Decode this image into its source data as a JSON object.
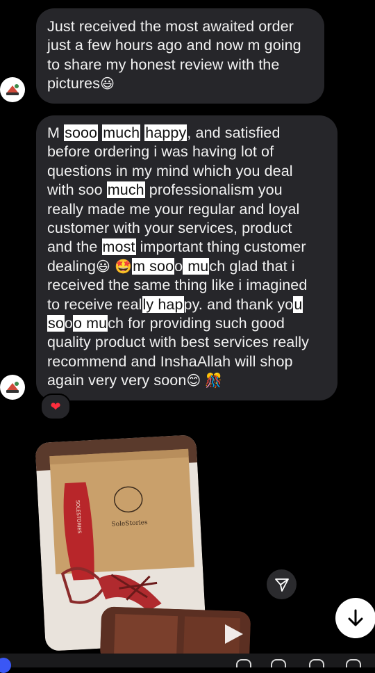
{
  "messages": [
    {
      "lines": [
        [
          {
            "t": "Just received the most awaited order"
          }
        ],
        [
          {
            "t": "just a few hours ago and now m going"
          }
        ],
        [
          {
            "t": "to share my honest review with the"
          }
        ],
        [
          {
            "t": "pictures"
          },
          {
            "t": "😃",
            "e": 1
          }
        ]
      ]
    },
    {
      "lines": [
        [
          {
            "t": "M "
          },
          {
            "t": "sooo",
            "h": 1
          },
          {
            "t": " "
          },
          {
            "t": "much",
            "h": 1
          },
          {
            "t": " "
          },
          {
            "t": "happy",
            "h": 1
          },
          {
            "t": ", and satisfied"
          }
        ],
        [
          {
            "t": "before ordering i was having lot of"
          }
        ],
        [
          {
            "t": "questions in my mind which you deal"
          }
        ],
        [
          {
            "t": "with soo "
          },
          {
            "t": "much",
            "h": 1
          },
          {
            "t": " professionalism you"
          }
        ],
        [
          {
            "t": "really made me your regular and loyal"
          }
        ],
        [
          {
            "t": "customer with your services, product"
          }
        ],
        [
          {
            "t": "and the "
          },
          {
            "t": "most",
            "h": 1
          },
          {
            "t": " important thing customer"
          }
        ],
        [
          {
            "t": "dealing"
          },
          {
            "t": "😃",
            "e": 1
          },
          {
            "t": " "
          },
          {
            "t": "🤩",
            "e": 1
          },
          {
            "t": "m soo",
            "h": 1
          },
          {
            "t": "o"
          },
          {
            "t": " mu",
            "h": 1
          },
          {
            "t": "ch glad that i"
          }
        ],
        [
          {
            "t": "received the same thing like i imagined"
          }
        ],
        [
          {
            "t": "to receive real"
          },
          {
            "t": "ly hap",
            "h": 1
          },
          {
            "t": "py. and thank yo"
          },
          {
            "t": "u",
            "h": 1
          }
        ],
        [
          {
            "t": "so",
            "h": 1
          },
          {
            "t": "o"
          },
          {
            "t": "o mu",
            "h": 1
          },
          {
            "t": "ch for providing such good"
          }
        ],
        [
          {
            "t": "quality product with best services really"
          }
        ],
        [
          {
            "t": "recommend and InshaAllah will shop"
          }
        ],
        [
          {
            "t": "again very very soon"
          },
          {
            "t": "😊",
            "e": 1
          },
          {
            "t": " "
          },
          {
            "t": "🎊",
            "e": 1
          }
        ]
      ]
    }
  ],
  "reaction": "❤",
  "photo": {
    "box_brand_side": "SOLESTORIES",
    "box_brand_front": "SoleStories"
  },
  "icons": {
    "share": "send-icon",
    "scroll": "arrow-down-icon",
    "play": "play-icon"
  },
  "colors": {
    "bubble": "#26262a",
    "highlight": "#ffffff",
    "background": "#000000",
    "heart": "#ff2d3d"
  }
}
